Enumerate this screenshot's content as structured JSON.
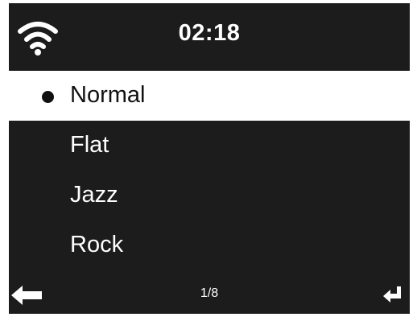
{
  "status_bar": {
    "time": "02:18",
    "wifi_icon": "wifi-icon"
  },
  "menu": {
    "items": [
      {
        "label": "Normal",
        "selected": true
      },
      {
        "label": "Flat",
        "selected": false
      },
      {
        "label": "Jazz",
        "selected": false
      },
      {
        "label": "Rock",
        "selected": false
      }
    ]
  },
  "footer": {
    "page_indicator": "1/8",
    "back_icon": "back-arrow-icon",
    "enter_icon": "enter-icon"
  },
  "colors": {
    "screen_background": "#1c1c1c",
    "highlight_background": "#ffffff",
    "text": "#ffffff",
    "selected_text": "#111111"
  }
}
